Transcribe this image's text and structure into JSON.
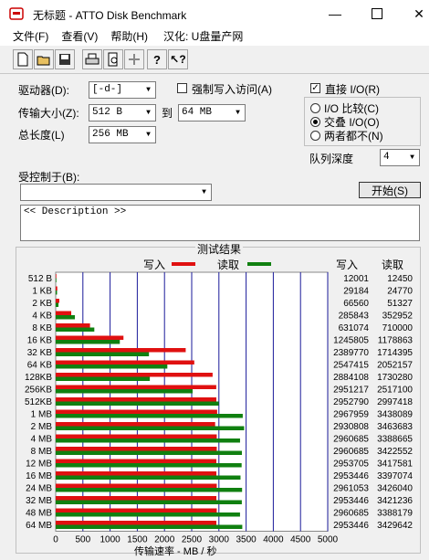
{
  "window": {
    "title": "无标题 - ATTO Disk Benchmark"
  },
  "menu": [
    "文件(F)",
    "查看(V)",
    "帮助(H)",
    "汉化: U盘量产网"
  ],
  "toolbar_icons": [
    "new-icon",
    "open-icon",
    "save-icon",
    "print-icon",
    "print-preview-icon",
    "move-icon",
    "help-icon",
    "context-help-icon"
  ],
  "settings": {
    "drive_label": "驱动器(D):",
    "drive_value": "[-d-]",
    "transfer_label": "传输大小(Z):",
    "transfer_from": "512 B",
    "transfer_to_label": "到",
    "transfer_to": "64 MB",
    "total_label": "总长度(L)",
    "total_value": "256 MB",
    "force_write_label": "强制写入访问(A)",
    "direct_io_label": "直接 I/O(R)",
    "io_compare": "I/O 比较(C)",
    "overlapped_io": "交叠 I/O(O)",
    "neither": "两者都不(N)",
    "queue_label": "队列深度",
    "queue_value": "4",
    "controlled_label": "受控制于(B):",
    "start_button": "开始(S)",
    "description": "<< Description >>"
  },
  "results": {
    "title": "测试结果",
    "write_legend": "写入",
    "read_legend": "读取",
    "col_write": "写入",
    "col_read": "读取",
    "xlabel": "传输速率 - MB / 秒",
    "write_color": "#e01010",
    "read_color": "#108010"
  },
  "chart_data": {
    "type": "bar",
    "orientation": "horizontal",
    "categories": [
      "512 B",
      "1 KB",
      "2 KB",
      "4 KB",
      "8 KB",
      "16 KB",
      "32 KB",
      "64 KB",
      "128KB",
      "256KB",
      "512KB",
      "1 MB",
      "2 MB",
      "4 MB",
      "8 MB",
      "12 MB",
      "16 MB",
      "24 MB",
      "32 MB",
      "48 MB",
      "64 MB"
    ],
    "series": [
      {
        "name": "写入",
        "values": [
          12001,
          29184,
          66560,
          285843,
          631074,
          1245805,
          2389770,
          2547415,
          2884108,
          2951217,
          2952790,
          2967959,
          2930808,
          2960685,
          2960685,
          2953705,
          2953446,
          2961053,
          2953446,
          2960685,
          2953446
        ]
      },
      {
        "name": "读取",
        "values": [
          12450,
          24770,
          51327,
          352952,
          710000,
          1178863,
          1714395,
          2052157,
          1730280,
          2517100,
          2997418,
          3438089,
          3463683,
          3388665,
          3422552,
          3417581,
          3397074,
          3426040,
          3421236,
          3388179,
          3429642
        ]
      }
    ],
    "xticks": [
      "0",
      "500",
      "1000",
      "1500",
      "2000",
      "2500",
      "3000",
      "3500",
      "4000",
      "4500",
      "5000"
    ],
    "xlim": [
      0,
      5000
    ],
    "xlabel": "传输速率 - MB / 秒"
  }
}
